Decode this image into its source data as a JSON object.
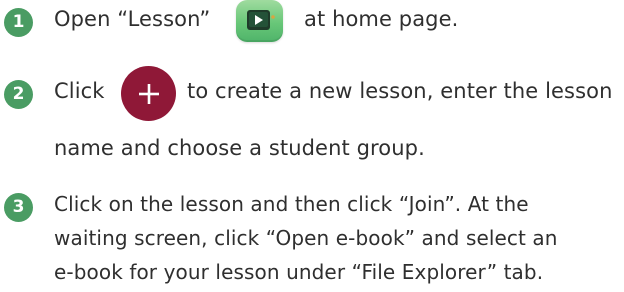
{
  "steps": [
    {
      "number": "1",
      "text_before_icon": "Open “Lesson”",
      "icon": "lesson-app-icon",
      "text_after_icon": "at home page."
    },
    {
      "number": "2",
      "text_before_icon": "Click",
      "icon": "plus-icon",
      "text_after_icon": "to create a new lesson, enter the lesson",
      "line2": "name and choose a student group."
    },
    {
      "number": "3",
      "line1": "Click on the lesson and then click “Join”. At the",
      "line2": "waiting screen, click “Open e-book” and select an",
      "line3": "e-book for your lesson under “File Explorer” tab."
    }
  ],
  "colors": {
    "badge_green": "#4a9c63",
    "plus_button": "#8f1837",
    "lesson_icon_bg": "#68c778",
    "text": "#2f2f2f"
  }
}
